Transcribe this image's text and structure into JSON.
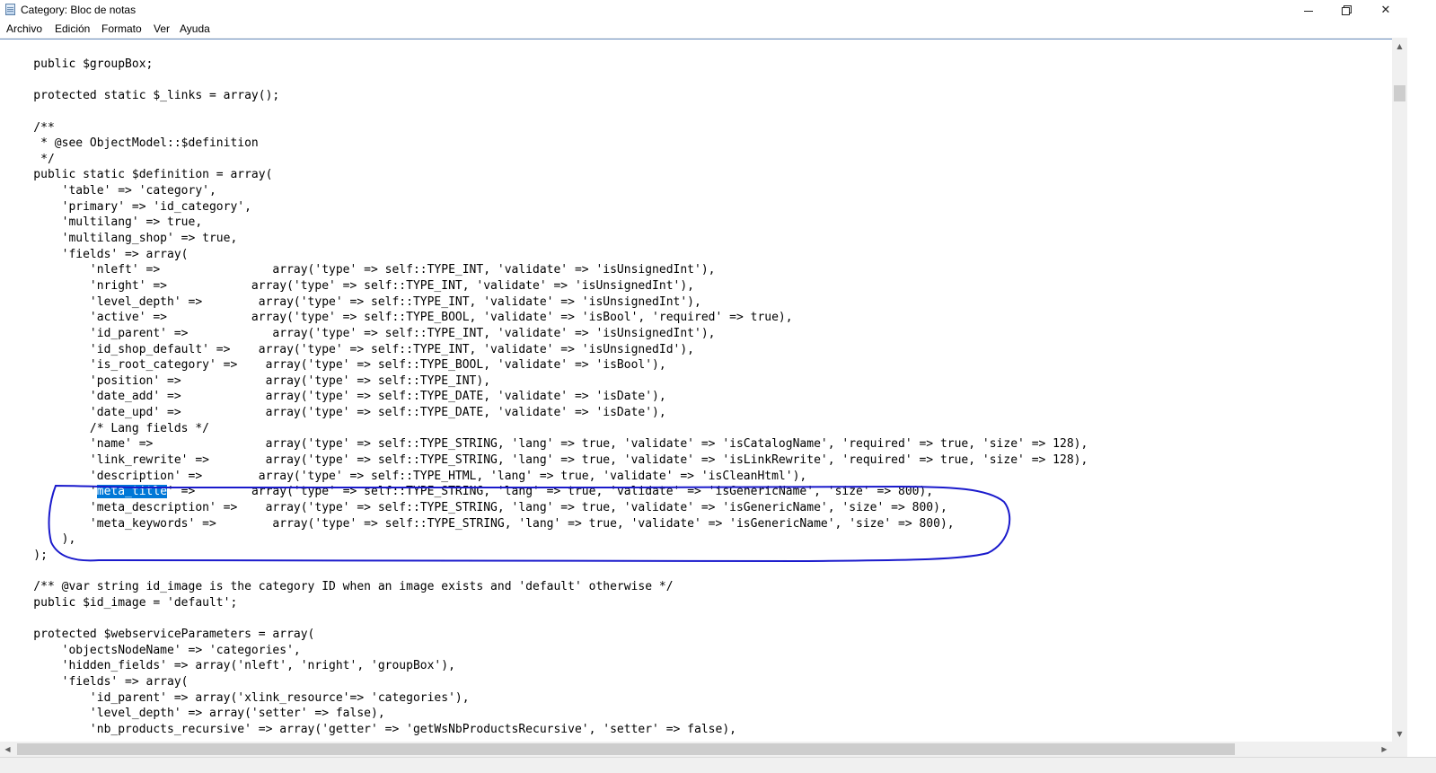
{
  "window": {
    "title": "Category: Bloc de notas",
    "icon": "notepad-icon",
    "controls": {
      "minimize_icon": "minimize-icon",
      "maximize_icon": "restore-icon",
      "close_label": "✕"
    }
  },
  "menu": {
    "items": [
      "Archivo",
      "Edición",
      "Formato",
      "Ver",
      "Ayuda"
    ]
  },
  "editor": {
    "selected_text": "meta_title",
    "selection_color": "#0078d7",
    "annotation_color": "#1a1acc",
    "lines": [
      "    public $groupBox;",
      "",
      "    protected static $_links = array();",
      "",
      "    /**",
      "     * @see ObjectModel::$definition",
      "     */",
      "    public static $definition = array(",
      "        'table' => 'category',",
      "        'primary' => 'id_category',",
      "        'multilang' => true,",
      "        'multilang_shop' => true,",
      "        'fields' => array(",
      "            'nleft' =>                array('type' => self::TYPE_INT, 'validate' => 'isUnsignedInt'),",
      "            'nright' =>            array('type' => self::TYPE_INT, 'validate' => 'isUnsignedInt'),",
      "            'level_depth' =>        array('type' => self::TYPE_INT, 'validate' => 'isUnsignedInt'),",
      "            'active' =>            array('type' => self::TYPE_BOOL, 'validate' => 'isBool', 'required' => true),",
      "            'id_parent' =>            array('type' => self::TYPE_INT, 'validate' => 'isUnsignedInt'),",
      "            'id_shop_default' =>    array('type' => self::TYPE_INT, 'validate' => 'isUnsignedId'),",
      "            'is_root_category' =>    array('type' => self::TYPE_BOOL, 'validate' => 'isBool'),",
      "            'position' =>            array('type' => self::TYPE_INT),",
      "            'date_add' =>            array('type' => self::TYPE_DATE, 'validate' => 'isDate'),",
      "            'date_upd' =>            array('type' => self::TYPE_DATE, 'validate' => 'isDate'),",
      "            /* Lang fields */",
      "            'name' =>                array('type' => self::TYPE_STRING, 'lang' => true, 'validate' => 'isCatalogName', 'required' => true, 'size' => 128),",
      "            'link_rewrite' =>        array('type' => self::TYPE_STRING, 'lang' => true, 'validate' => 'isLinkRewrite', 'required' => true, 'size' => 128),",
      "            'description' =>        array('type' => self::TYPE_HTML, 'lang' => true, 'validate' => 'isCleanHtml'),",
      "            'meta_title' =>        array('type' => self::TYPE_STRING, 'lang' => true, 'validate' => 'isGenericName', 'size' => 800),",
      "            'meta_description' =>    array('type' => self::TYPE_STRING, 'lang' => true, 'validate' => 'isGenericName', 'size' => 800),",
      "            'meta_keywords' =>        array('type' => self::TYPE_STRING, 'lang' => true, 'validate' => 'isGenericName', 'size' => 800),",
      "        ),",
      "    );",
      "",
      "    /** @var string id_image is the category ID when an image exists and 'default' otherwise */",
      "    public $id_image = 'default';",
      "",
      "    protected $webserviceParameters = array(",
      "        'objectsNodeName' => 'categories',",
      "        'hidden_fields' => array('nleft', 'nright', 'groupBox'),",
      "        'fields' => array(",
      "            'id_parent' => array('xlink_resource'=> 'categories'),",
      "            'level_depth' => array('setter' => false),",
      "            'nb_products_recursive' => array('getter' => 'getWsNbProductsRecursive', 'setter' => false),"
    ]
  },
  "scrollbars": {
    "vertical": {
      "up_icon": "scroll-up-arrow-icon",
      "down_icon": "scroll-down-arrow-icon"
    },
    "horizontal": {
      "left_icon": "scroll-left-arrow-icon",
      "right_icon": "scroll-right-arrow-icon"
    }
  }
}
